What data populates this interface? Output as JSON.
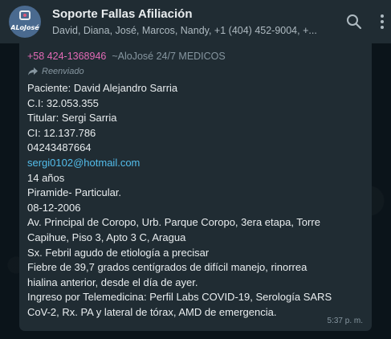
{
  "header": {
    "title": "Soporte Fallas Afiliación",
    "subtitle": "David, Diana, José, Marcos, Nandy, +1 (404) 452-9004, +...",
    "avatar_logo_text": "ALoJosé",
    "icons": [
      "search-icon",
      "menu-icon"
    ]
  },
  "message": {
    "sender_phone": "+58 424-1368946",
    "sender_name": "~AloJosé 24/7 MEDICOS",
    "forwarded_label": "Reenviado",
    "lines": [
      "Paciente: David Alejandro Sarria",
      "C.I: 32.053.355",
      "Titular: Sergi Sarria",
      "CI: 12.137.786",
      "04243487664"
    ],
    "email": "sergi0102@hotmail.com",
    "lines_after": [
      "14 años",
      "Piramide- Particular.",
      "08-12-2006",
      "Av. Principal de Coropo, Urb. Parque Coropo, 3era etapa, Torre",
      "Capihue, Piso 3, Apto 3 C, Aragua",
      "Sx. Febril agudo de etiología a precisar",
      "Fiebre de 39,7 grados centígrados de difícil manejo, rinorrea",
      "hialina anterior, desde el día de ayer.",
      "Ingreso por Telemedicina: Perfil Labs COVID-19, Serología SARS",
      "CoV-2, Rx. PA y lateral de tórax, AMD de emergencia."
    ],
    "time": "5:37 p. m."
  },
  "colors": {
    "background": "#0b141a",
    "header": "#202c33",
    "bubble": "#202c33",
    "sender_phone": "#e26ab6",
    "link": "#53bdeb",
    "primary_text": "#e9edef",
    "secondary_text": "#8696a0"
  }
}
